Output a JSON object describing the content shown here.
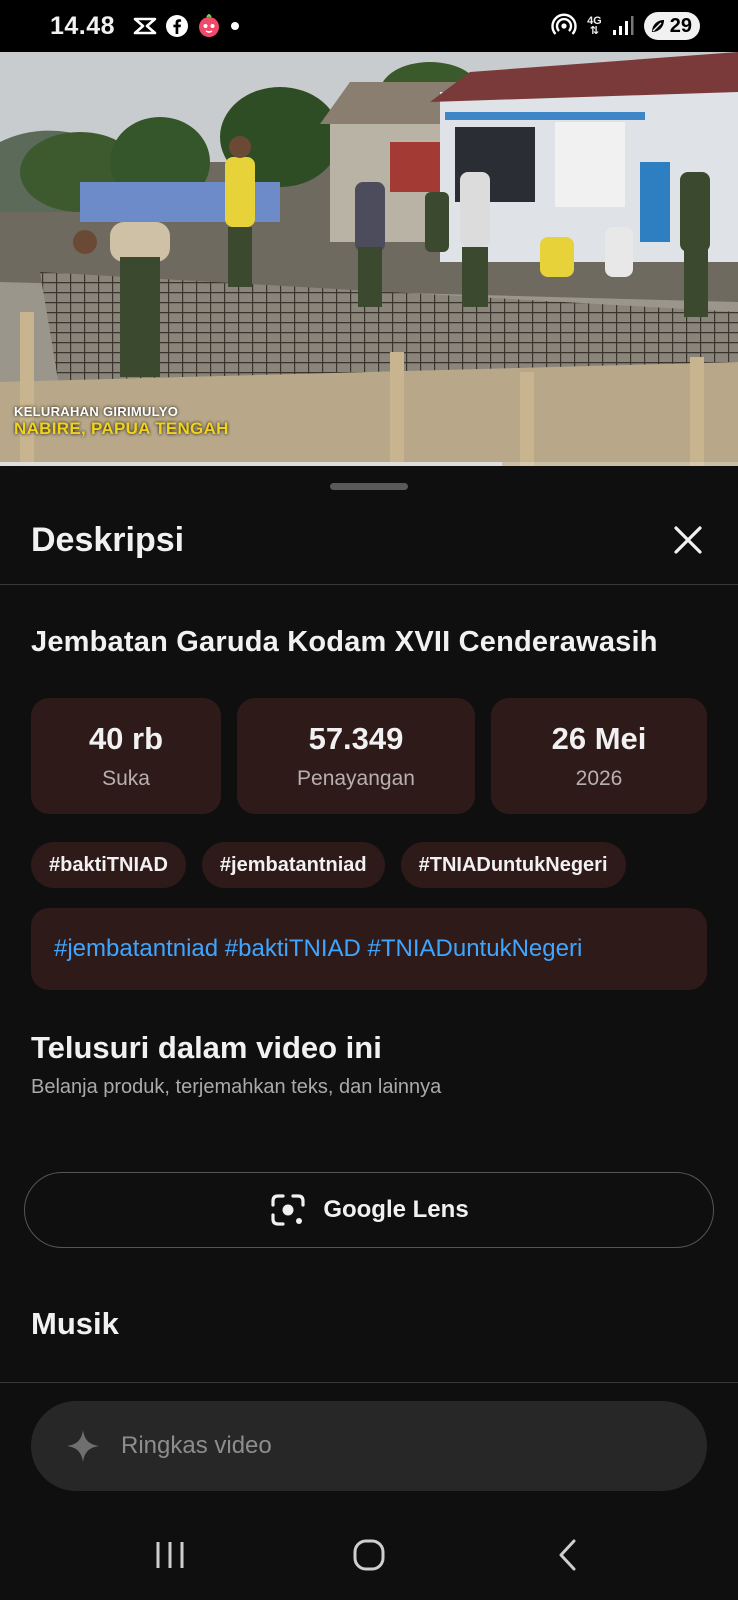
{
  "status_bar": {
    "time": "14.48",
    "network": "4G",
    "battery": "29",
    "icons_left": [
      "capcut-icon",
      "facebook-icon",
      "app-notification-icon",
      "dot-icon"
    ],
    "icons_right": [
      "hotspot-icon",
      "network-4g-icon",
      "signal-icon",
      "battery-icon"
    ]
  },
  "video": {
    "caption_line1": "KELURAHAN GIRIMULYO",
    "caption_line2": "NABIRE, PAPUA TENGAH",
    "progress": 0.68
  },
  "sheet": {
    "title": "Deskripsi",
    "close_icon": "close-icon"
  },
  "details": {
    "video_title": "Jembatan Garuda Kodam XVII Cenderawasih",
    "stats": [
      {
        "value": "40 rb",
        "label": "Suka"
      },
      {
        "value": "57.349",
        "label": "Penayangan"
      },
      {
        "value": "26 Mei",
        "label": "2026"
      }
    ],
    "tags": [
      "#baktiTNIAD",
      "#jembatantniad",
      "#TNIADuntukNegeri"
    ],
    "description_hashtags": [
      "#jembatantniad",
      "#baktiTNIAD",
      "#TNIADuntukNegeri"
    ]
  },
  "explore": {
    "title": "Telusuri dalam video ini",
    "subtitle": "Belanja produk, terjemahkan teks, dan lainnya",
    "lens_label": "Google Lens"
  },
  "music": {
    "title": "Musik"
  },
  "summary": {
    "placeholder": "Ringkas video",
    "icon": "sparkle-icon"
  },
  "colors": {
    "background": "#0f0f0f",
    "card": "#2f1a1a",
    "link": "#3ea6ff",
    "caption_yellow": "#f3d21a"
  }
}
